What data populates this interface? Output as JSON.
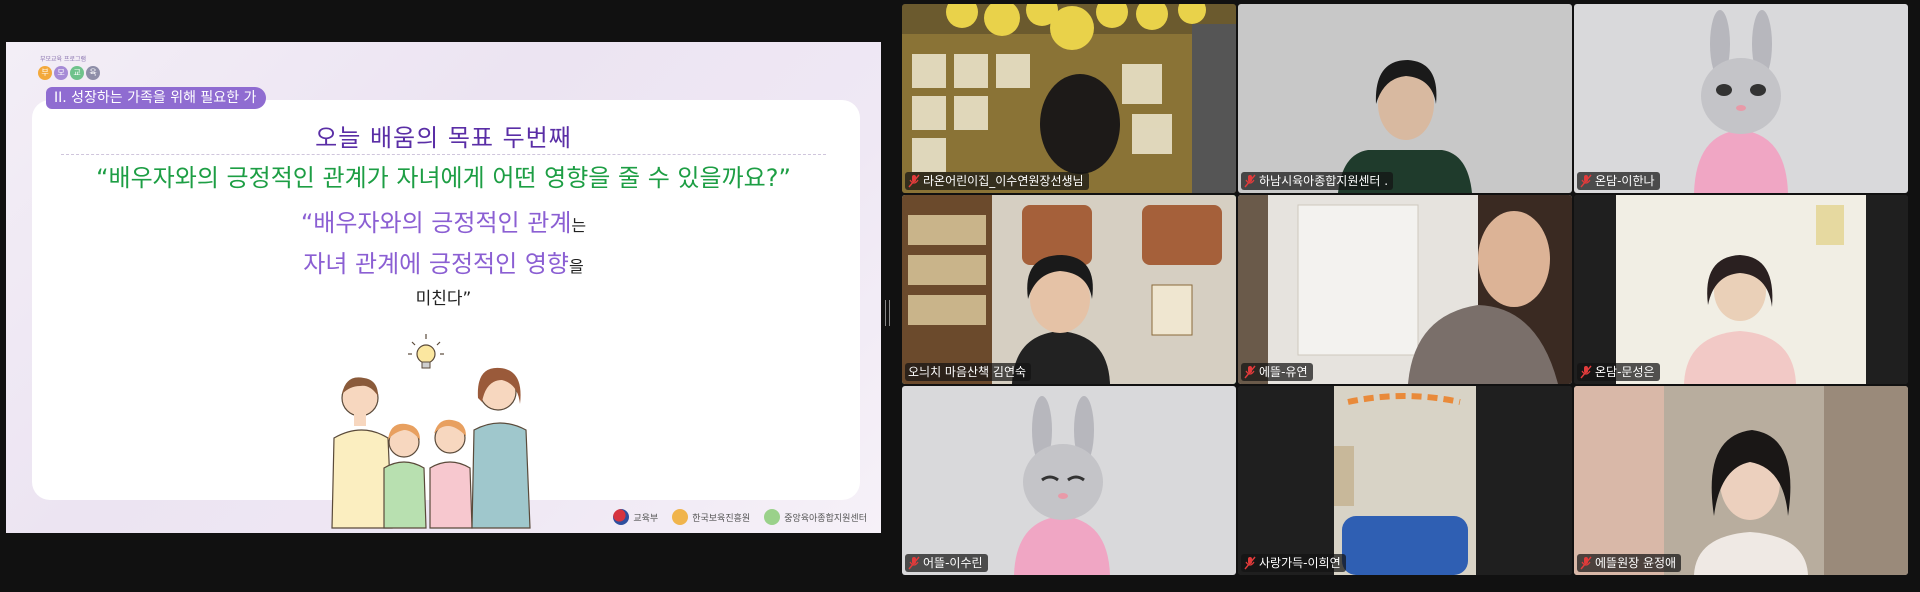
{
  "slide": {
    "logo_subtitle": "부모교육 프로그램",
    "logo_letters": [
      "부",
      "모",
      "교",
      "육"
    ],
    "section_tag": "II. 성장하는 가족을 위해 필요한 가",
    "goal_title": "오늘 배움의 목표 두번째",
    "question": "“배우자와의 긍정적인 관계가 자녀에게 어떤 영향을 줄 수 있을까요?”",
    "quote": {
      "line1_highlight": "“배우자와의 긍정적인 관계",
      "line1_suffix": "는",
      "line2_highlight": "자녀 관계에 긍정적인 영향",
      "line2_suffix": "을",
      "line3": "미친다”"
    },
    "footer": {
      "org1": "교육부",
      "org2": "한국보육진흥원",
      "org3": "중앙육아종합지원센터"
    }
  },
  "gallery": {
    "participants": [
      {
        "name": "라온어린이집_이수연원장선생님",
        "muted": true,
        "active": false
      },
      {
        "name": "하남시육아종합지원센터 .",
        "muted": true,
        "active": false
      },
      {
        "name": "온담-이한나",
        "muted": true,
        "active": false
      },
      {
        "name": "오늬치 마음산책 김연숙",
        "muted": false,
        "active": true
      },
      {
        "name": "에뜰-유연",
        "muted": true,
        "active": false
      },
      {
        "name": "온담-문성은",
        "muted": true,
        "active": false
      },
      {
        "name": "어뜰-이수린",
        "muted": true,
        "active": false
      },
      {
        "name": "사랑가득-이희연",
        "muted": true,
        "active": false
      },
      {
        "name": "에뜰원장 윤정애",
        "muted": true,
        "active": false
      }
    ]
  },
  "colors": {
    "accent_purple": "#8f6cd1",
    "title_purple": "#5a2ea6",
    "question_green": "#1d9e44",
    "active_speaker": "#3ac77a"
  }
}
